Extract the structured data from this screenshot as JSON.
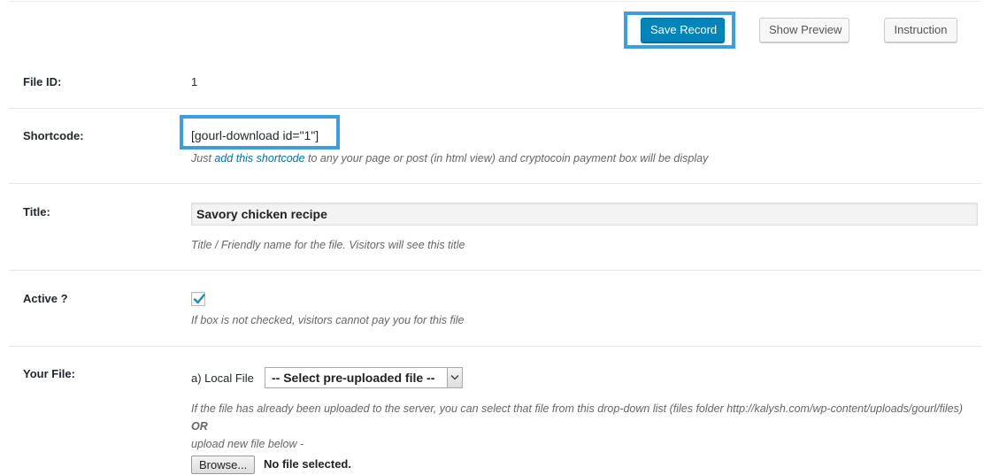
{
  "toolbar": {
    "save_label": "Save Record",
    "preview_label": "Show Preview",
    "instruction_label": "Instruction"
  },
  "fields": {
    "file_id": {
      "label": "File ID:",
      "value": "1"
    },
    "shortcode": {
      "label": "Shortcode:",
      "value": "[gourl-download id=\"1\"]",
      "desc_before": "Just ",
      "desc_link": "add this shortcode",
      "desc_after": " to any your page or post (in html view) and cryptocoin payment box will be display"
    },
    "title": {
      "label": "Title:",
      "value": "Savory chicken recipe",
      "desc": "Title / Friendly name for the file. Visitors will see this title"
    },
    "active": {
      "label": "Active ?",
      "checked": true,
      "desc": "If box is not checked, visitors cannot pay you for this file"
    },
    "your_file": {
      "label": "Your File:",
      "local_file_label": "a) Local File",
      "select_value": "-- Select pre-uploaded file --",
      "desc1": "If the file has already been uploaded to the server, you can select that file from this drop-down list (files folder http://kalysh.com/wp-content/uploads/gourl/files)",
      "or_text": "OR",
      "desc2": "upload new file below -",
      "browse_label": "Browse...",
      "no_file_text": "No file selected."
    }
  },
  "colors": {
    "primary_button": "#0085ba",
    "highlight": "#3a9ee4",
    "link": "#0073aa"
  }
}
